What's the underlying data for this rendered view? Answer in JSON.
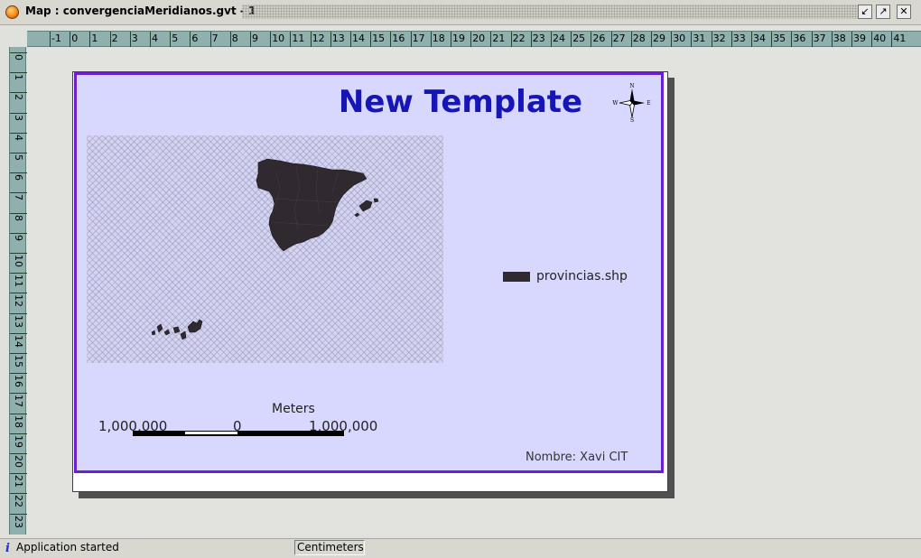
{
  "window": {
    "title": "Map : convergenciaMeridianos.gvt - 1",
    "icons": {
      "app": "app-orb-icon",
      "minimize": "minimize-icon",
      "maximize": "maximize-icon",
      "close": "close-icon"
    }
  },
  "ruler": {
    "units": "Centimeters",
    "horizontal_labels": [
      "-1",
      "0",
      "1",
      "2",
      "3",
      "4",
      "5",
      "6",
      "7",
      "8",
      "9",
      "10",
      "11",
      "12",
      "13",
      "14",
      "15",
      "16",
      "17",
      "18",
      "19",
      "20",
      "21",
      "22",
      "23",
      "24",
      "25",
      "26",
      "27",
      "28",
      "29",
      "30",
      "31",
      "32",
      "33",
      "34",
      "35",
      "36",
      "37",
      "38",
      "39",
      "40",
      "41"
    ],
    "vertical_labels": [
      "0",
      "1",
      "2",
      "3",
      "4",
      "5",
      "6",
      "7",
      "8",
      "9",
      "10",
      "11",
      "12",
      "13",
      "14",
      "15",
      "16",
      "17",
      "18",
      "19",
      "20",
      "21",
      "22",
      "23"
    ]
  },
  "layout": {
    "title": "New Template",
    "north_arrow": {
      "n": "N",
      "s": "S",
      "e": "E",
      "w": "W"
    },
    "legend": {
      "layer": "provincias.shp",
      "swatch_color": "#2e2a30"
    },
    "scalebar": {
      "units": "Meters",
      "left_label": "1,000,000",
      "center_label": "0",
      "right_label": "1,000,000"
    },
    "author_text": "Nombre: Xavi CIT",
    "frame_color": "#6a1fd0",
    "title_color": "#1515b8",
    "map_fill": "#302a30"
  },
  "status": {
    "info_icon": "info-icon",
    "message": "Application started",
    "units": "Centimeters"
  }
}
